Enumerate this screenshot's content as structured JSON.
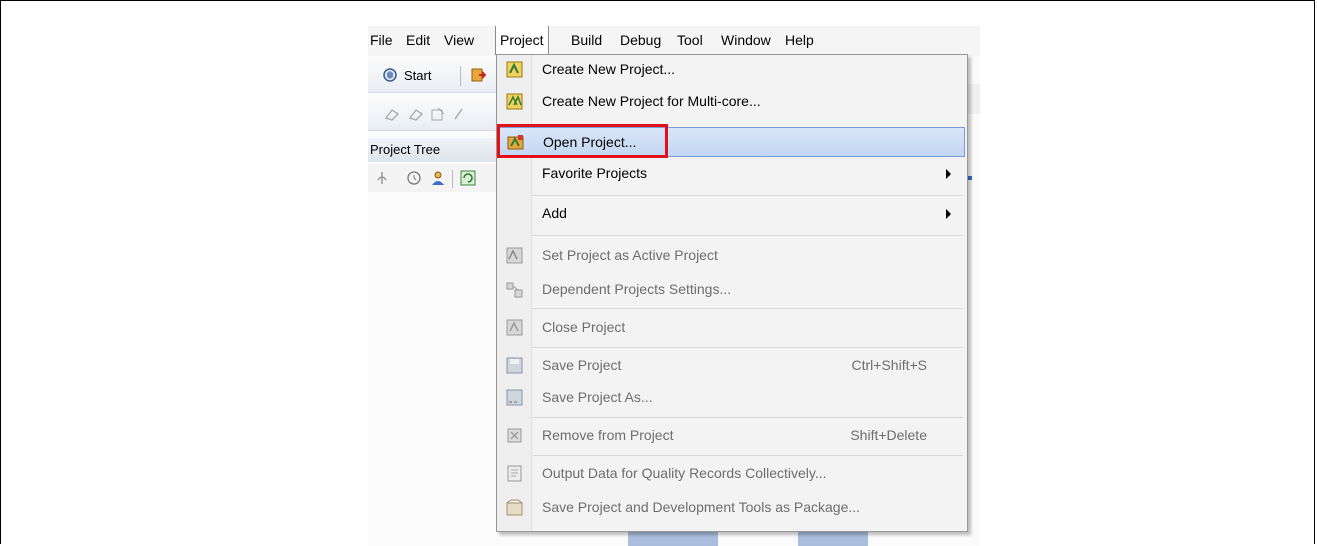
{
  "menubar": {
    "items": [
      "File",
      "Edit",
      "View",
      "Project",
      "Build",
      "Debug",
      "Tool",
      "Window",
      "Help"
    ],
    "active": "Project"
  },
  "toolbar": {
    "start_label": "Start"
  },
  "project_tree": {
    "title": "Project Tree"
  },
  "project_menu": {
    "items": [
      {
        "label": "Create New Project...",
        "icon": "create-project-icon",
        "enabled": true
      },
      {
        "label": "Create New Project for Multi-core...",
        "icon": "create-multicore-icon",
        "enabled": true
      },
      {
        "label": "Open Project...",
        "icon": "open-project-icon",
        "enabled": true,
        "highlighted": true
      },
      {
        "label": "Favorite Projects",
        "submenu": true,
        "enabled": true
      },
      {
        "label": "Add",
        "submenu": true,
        "enabled": true
      },
      {
        "label": "Set Project as Active Project",
        "icon": "active-project-icon",
        "enabled": false
      },
      {
        "label": "Dependent Projects Settings...",
        "icon": "dependent-settings-icon",
        "enabled": false
      },
      {
        "label": "Close Project",
        "icon": "close-project-icon",
        "enabled": false
      },
      {
        "label": "Save Project",
        "shortcut": "Ctrl+Shift+S",
        "icon": "save-project-icon",
        "enabled": false
      },
      {
        "label": "Save Project As...",
        "icon": "save-as-icon",
        "enabled": false
      },
      {
        "label": "Remove from Project",
        "shortcut": "Shift+Delete",
        "icon": "remove-icon",
        "enabled": false
      },
      {
        "label": "Output Data for Quality Records Collectively...",
        "icon": "output-data-icon",
        "enabled": false
      },
      {
        "label": "Save Project and Development Tools as Package...",
        "icon": "package-icon",
        "enabled": false
      }
    ]
  },
  "colors": {
    "highlight_box": "#e3101a",
    "menu_highlight": "#c3d6f3"
  }
}
